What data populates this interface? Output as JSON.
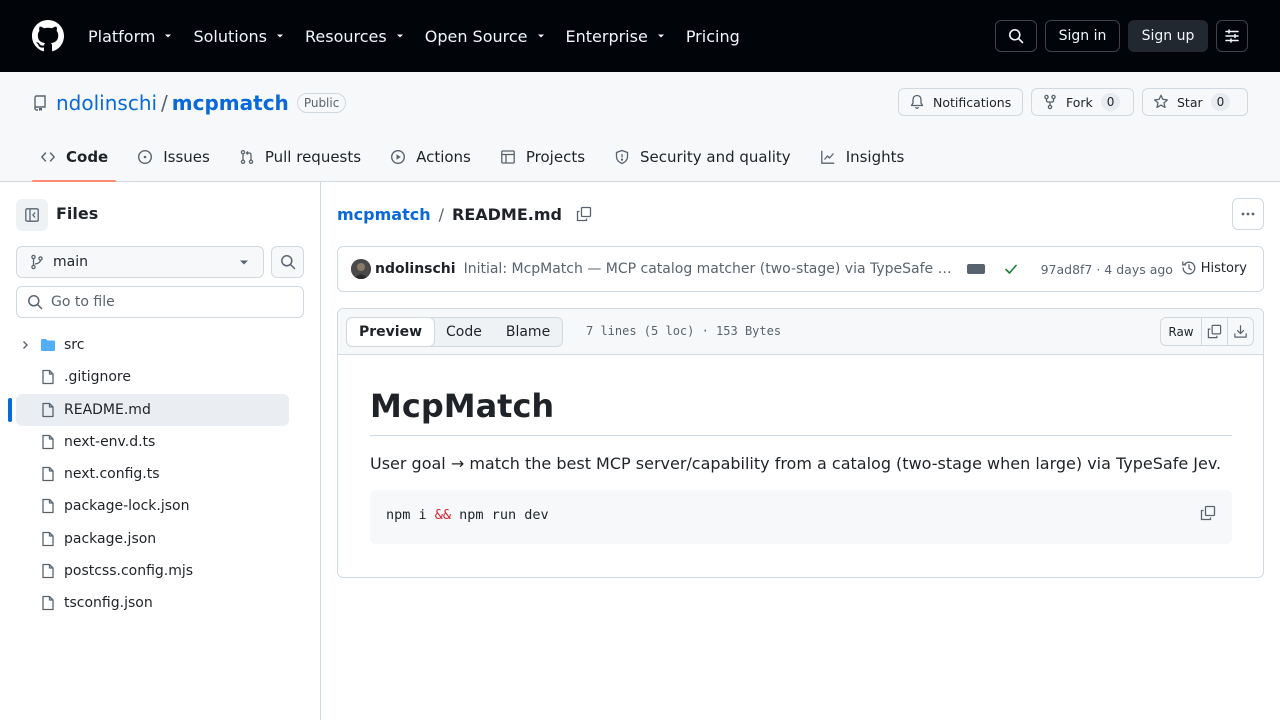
{
  "header": {
    "nav": [
      "Platform",
      "Solutions",
      "Resources",
      "Open Source",
      "Enterprise"
    ],
    "pricing": "Pricing",
    "sign_in": "Sign in",
    "sign_up": "Sign up"
  },
  "repo": {
    "owner": "ndolinschi",
    "separator": "/",
    "name": "mcpmatch",
    "visibility": "Public",
    "notifications_label": "Notifications",
    "fork_label": "Fork",
    "fork_count": "0",
    "star_label": "Star",
    "star_count": "0"
  },
  "tabs": [
    {
      "label": "Code",
      "icon": "code-icon"
    },
    {
      "label": "Issues",
      "icon": "issue-icon"
    },
    {
      "label": "Pull requests",
      "icon": "pull-request-icon"
    },
    {
      "label": "Actions",
      "icon": "play-icon"
    },
    {
      "label": "Projects",
      "icon": "table-icon"
    },
    {
      "label": "Security and quality",
      "icon": "shield-icon"
    },
    {
      "label": "Insights",
      "icon": "graph-icon"
    }
  ],
  "sidebar": {
    "title": "Files",
    "branch": "main",
    "goto_placeholder": "Go to file",
    "tree": [
      {
        "name": "src",
        "type": "folder"
      },
      {
        "name": ".gitignore",
        "type": "file"
      },
      {
        "name": "README.md",
        "type": "file",
        "selected": true
      },
      {
        "name": "next-env.d.ts",
        "type": "file"
      },
      {
        "name": "next.config.ts",
        "type": "file"
      },
      {
        "name": "package-lock.json",
        "type": "file"
      },
      {
        "name": "package.json",
        "type": "file"
      },
      {
        "name": "postcss.config.mjs",
        "type": "file"
      },
      {
        "name": "tsconfig.json",
        "type": "file"
      }
    ]
  },
  "breadcrumb": {
    "repo": "mcpmatch",
    "sep": "/",
    "file": "README.md"
  },
  "commit": {
    "author": "ndolinschi",
    "message": "Initial: McpMatch — MCP catalog matcher (two-stage) via TypeSafe Jev",
    "sha_time": "97ad8f7 · 4 days ago",
    "history": "History"
  },
  "file": {
    "view_tabs": [
      "Preview",
      "Code",
      "Blame"
    ],
    "info": "7 lines (5 loc) · 153 Bytes",
    "raw": "Raw"
  },
  "readme": {
    "h1": "McpMatch",
    "paragraph": "User goal → match the best MCP server/capability from a catalog (two-stage when large) via TypeSafe Jev.",
    "code_a": "npm i ",
    "code_amp": "&&",
    "code_b": " npm run dev"
  },
  "colors": {
    "header_bg": "#010409",
    "link": "#0969da",
    "active_tab_underline": "#fd8c73",
    "success": "#1a7f37"
  }
}
